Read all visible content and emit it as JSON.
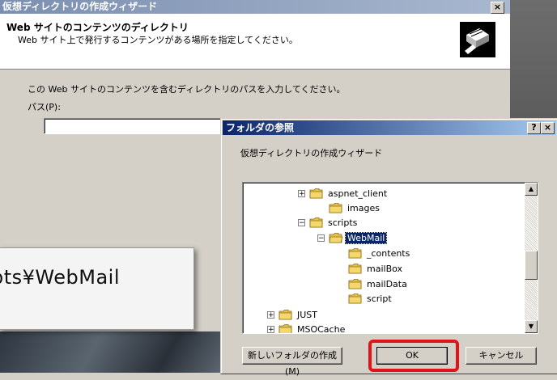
{
  "wizard": {
    "title": "仮想ディレクトリの作成ウィザード",
    "close_label": "×",
    "header_title": "Web サイトのコンテンツのディレクトリ",
    "header_subtitle": "Web サイト上で発行するコンテンツがある場所を指定してください。",
    "instruction": "この Web サイトのコンテンツを含むディレクトリのパスを入力してください。",
    "path_label": "パス(P):",
    "path_value": ""
  },
  "callout": {
    "text": "pts¥WebMail"
  },
  "dialog": {
    "title": "フォルダの参照",
    "help_label": "?",
    "close_label": "×",
    "description": "仮想ディレクトリの作成ウィザード",
    "tree": [
      {
        "label": "aspnet_client",
        "toggle": "+",
        "selected": false
      },
      {
        "label": "images",
        "toggle": "",
        "selected": false
      },
      {
        "label": "scripts",
        "toggle": "−",
        "selected": false
      },
      {
        "label": "WebMail",
        "toggle": "−",
        "selected": true
      },
      {
        "label": "_contents",
        "toggle": "",
        "selected": false
      },
      {
        "label": "mailBox",
        "toggle": "",
        "selected": false
      },
      {
        "label": "mailData",
        "toggle": "",
        "selected": false
      },
      {
        "label": "script",
        "toggle": "",
        "selected": false
      },
      {
        "label": "JUST",
        "toggle": "+",
        "selected": false
      },
      {
        "label": "MSOCache",
        "toggle": "+",
        "selected": false
      }
    ],
    "buttons": {
      "new_folder": "新しいフォルダの作成(M)",
      "ok": "OK",
      "cancel": "キャンセル"
    }
  },
  "colors": {
    "highlight": "#e0131a",
    "selection": "#0a246a",
    "folder": "#f5d86b"
  }
}
